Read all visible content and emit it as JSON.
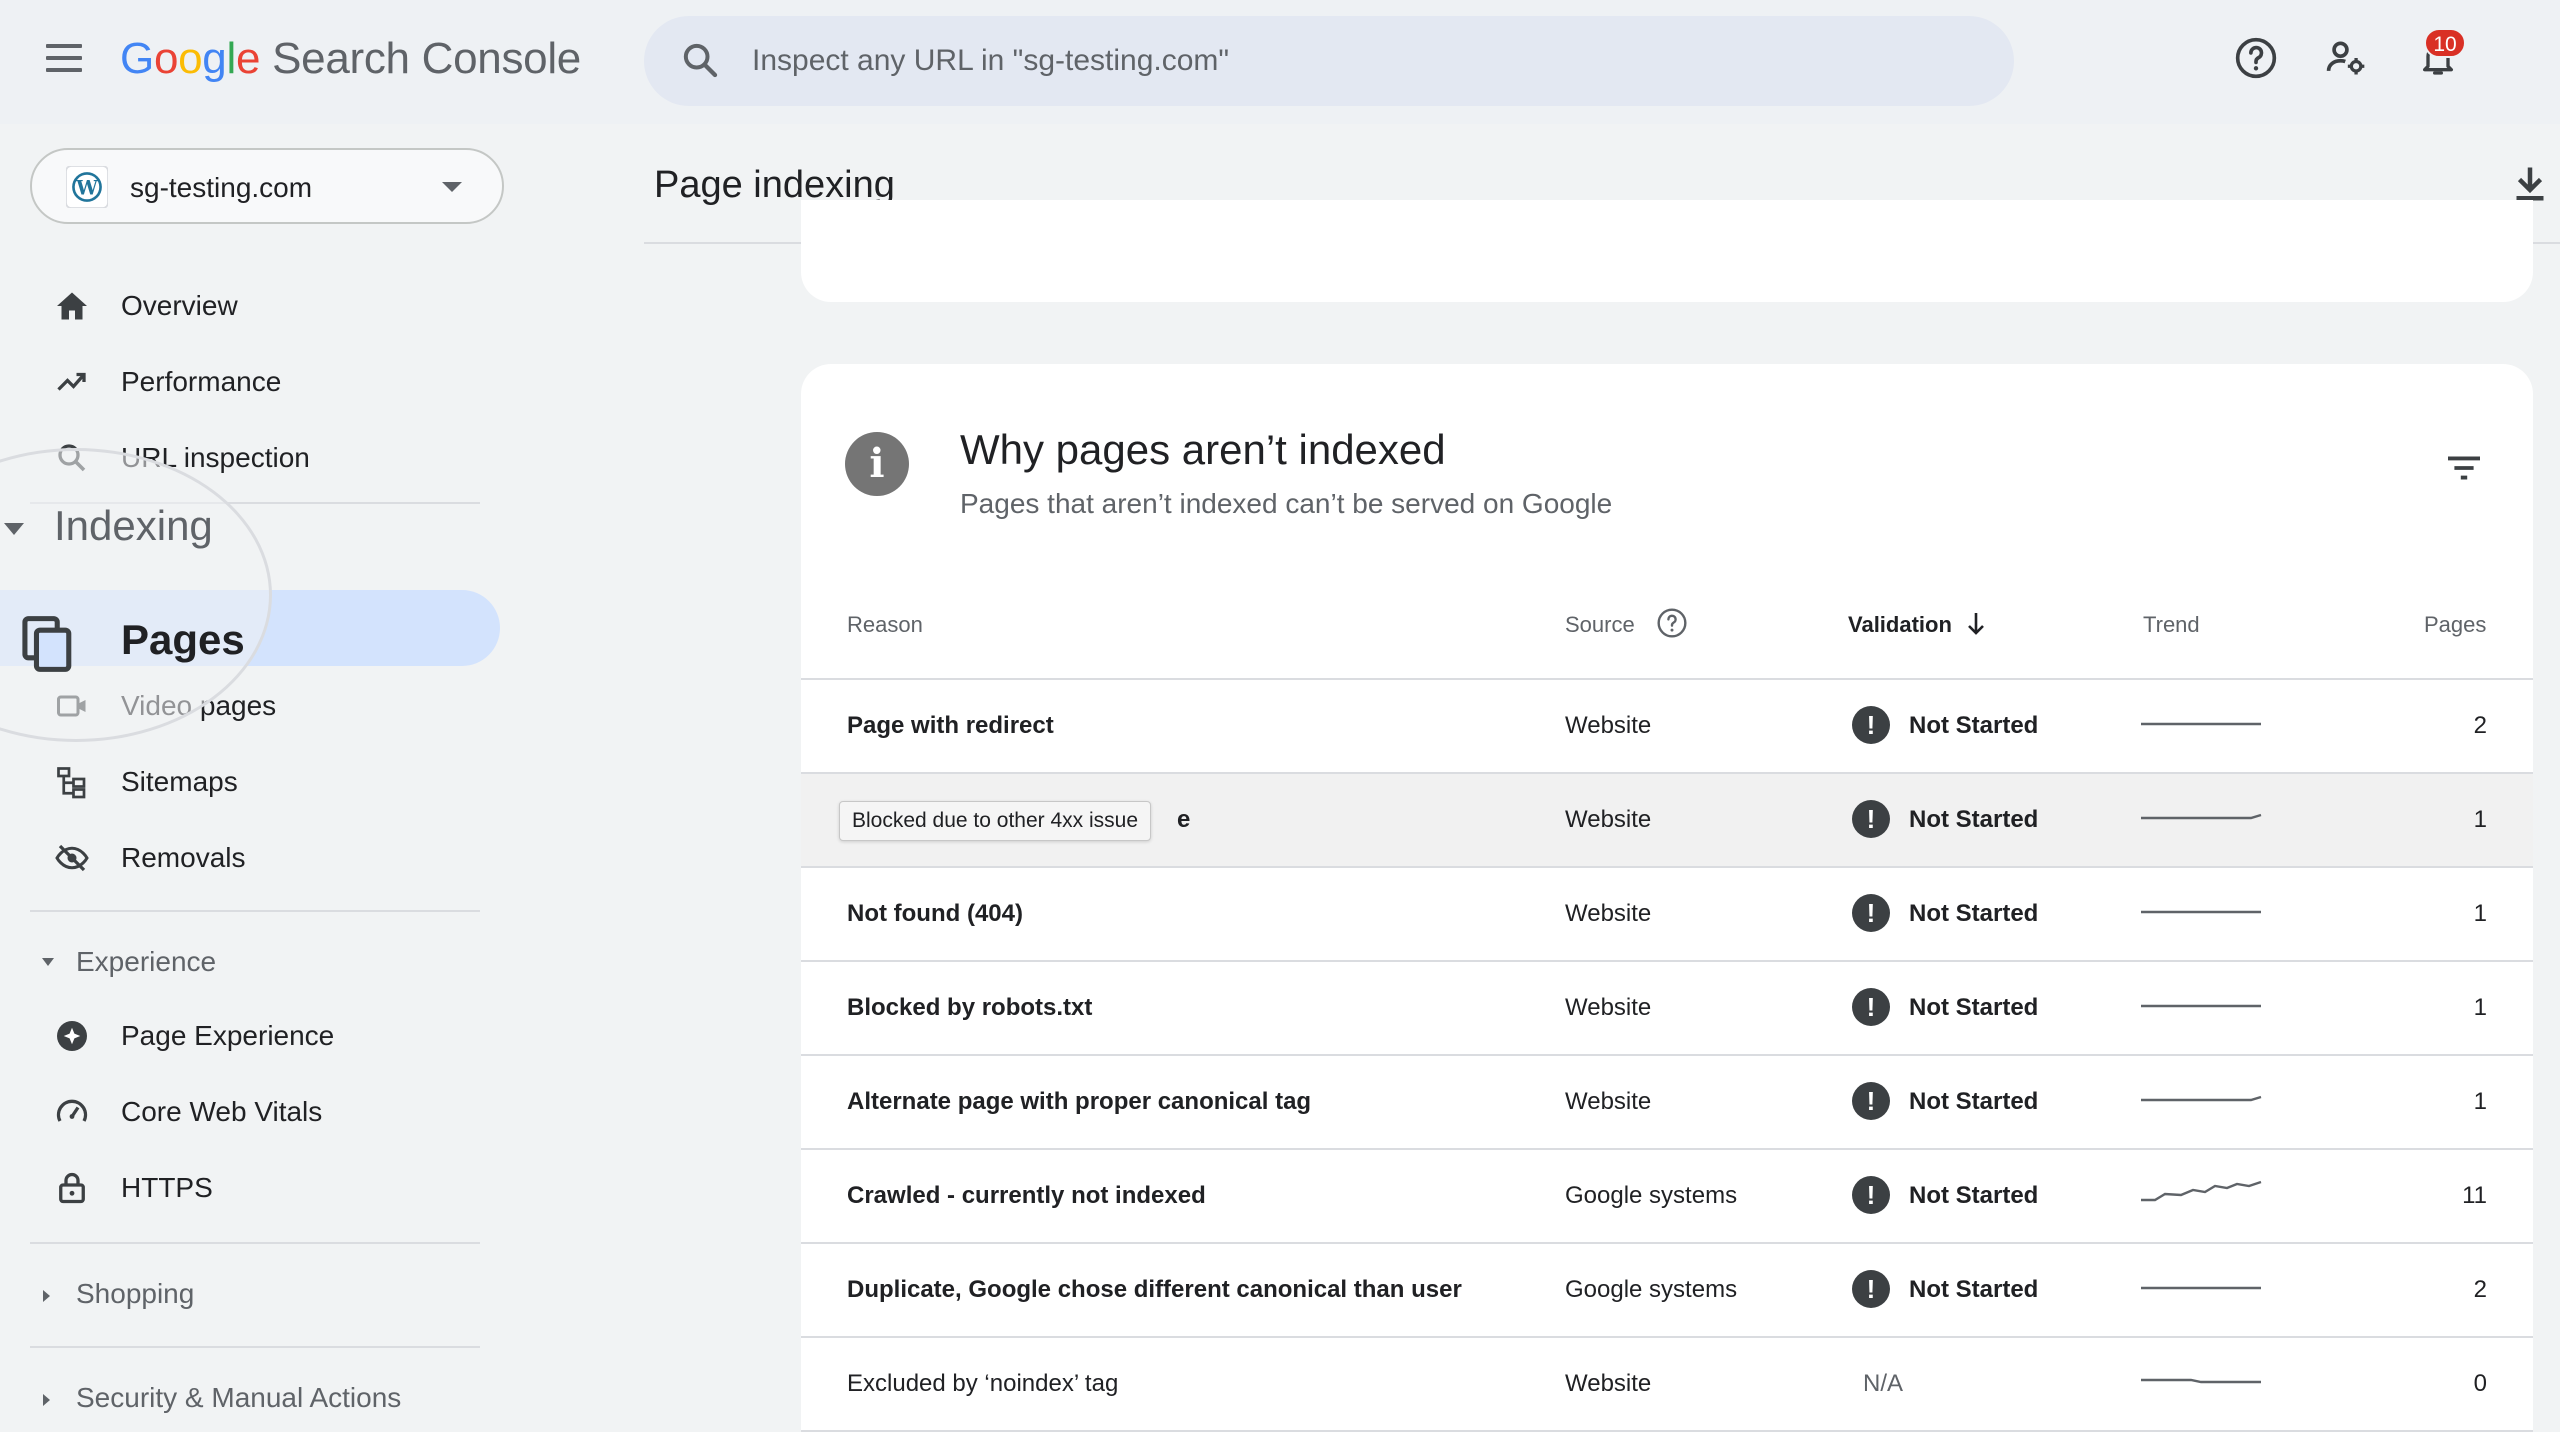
{
  "header": {
    "product_name": "Search Console",
    "search_placeholder": "Inspect any URL in \"sg-testing.com\"",
    "notification_count": "10"
  },
  "sidebar": {
    "property": "sg-testing.com",
    "items": [
      {
        "label": "Overview",
        "icon": "home-icon"
      },
      {
        "label": "Performance",
        "icon": "trending-up-icon"
      },
      {
        "label": "URL inspection",
        "icon": "search-icon"
      }
    ],
    "indexing_header": "Indexing",
    "indexing_items": [
      {
        "label": "Pages",
        "icon": "pages-icon"
      },
      {
        "label": "Video pages",
        "icon": "video-icon"
      },
      {
        "label": "Sitemaps",
        "icon": "sitemap-icon"
      },
      {
        "label": "Removals",
        "icon": "eye-off-icon"
      }
    ],
    "experience_header": "Experience",
    "experience_items": [
      {
        "label": "Page Experience",
        "icon": "plus-circle-icon"
      },
      {
        "label": "Core Web Vitals",
        "icon": "speedometer-icon"
      },
      {
        "label": "HTTPS",
        "icon": "lock-icon"
      }
    ],
    "shopping_header": "Shopping",
    "security_header": "Security & Manual Actions"
  },
  "main": {
    "title": "Page indexing",
    "card_title": "Why pages aren’t indexed",
    "card_subtitle": "Pages that aren’t indexed can’t be served on Google",
    "columns": {
      "reason": "Reason",
      "source": "Source",
      "validation": "Validation",
      "trend": "Trend",
      "pages": "Pages"
    },
    "rows": [
      {
        "reason": "Page with redirect",
        "source": "Website",
        "validation": "Not Started",
        "pages": "2"
      },
      {
        "reason": "e",
        "source": "Website",
        "validation": "Not Started",
        "pages": "1"
      },
      {
        "reason": "Not found (404)",
        "source": "Website",
        "validation": "Not Started",
        "pages": "1"
      },
      {
        "reason": "Blocked by robots.txt",
        "source": "Website",
        "validation": "Not Started",
        "pages": "1"
      },
      {
        "reason": "Alternate page with proper canonical tag",
        "source": "Website",
        "validation": "Not Started",
        "pages": "1"
      },
      {
        "reason": "Crawled - currently not indexed",
        "source": "Google systems",
        "validation": "Not Started",
        "pages": "11"
      },
      {
        "reason": "Duplicate, Google chose different canonical than user",
        "source": "Google systems",
        "validation": "Not Started",
        "pages": "2"
      },
      {
        "reason": "Excluded by ‘noindex’ tag",
        "source": "Website",
        "validation": "N/A",
        "pages": "0"
      }
    ],
    "tooltip": "Blocked due to other 4xx issue"
  }
}
